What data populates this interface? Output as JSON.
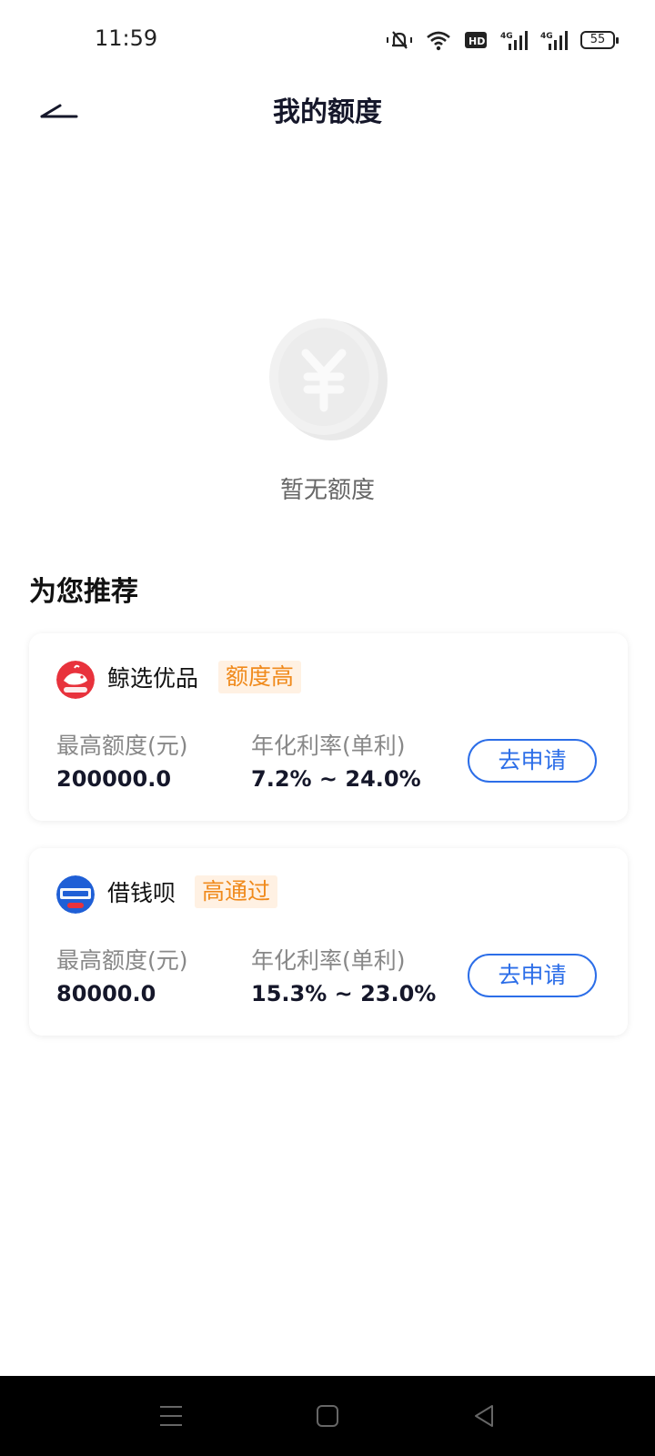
{
  "status_bar": {
    "time": "11:59",
    "network_1": "4G",
    "network_2": "4G",
    "hd_label": "HD",
    "battery": "55"
  },
  "header": {
    "title": "我的额度"
  },
  "empty_state": {
    "text": "暂无额度"
  },
  "section": {
    "title": "为您推荐"
  },
  "products": [
    {
      "name": "鲸选优品",
      "tag": "额度高",
      "max_label": "最高额度(元)",
      "max_value": "200000.0",
      "rate_label": "年化利率(单利)",
      "rate_value": "7.2% ~ 24.0%",
      "button": "去申请",
      "logo_color": "#e8323c"
    },
    {
      "name": "借钱呗",
      "tag": "高通过",
      "max_label": "最高额度(元)",
      "max_value": "80000.0",
      "rate_label": "年化利率(单利)",
      "rate_value": "15.3% ~ 23.0%",
      "button": "去申请",
      "logo_color": "#1f5fd6"
    }
  ],
  "colors": {
    "accent_blue": "#2c6ee8",
    "tag_orange": "#f08a1c",
    "tag_bg": "#fff1e3"
  },
  "icons": [
    "back-arrow-icon",
    "silent-icon",
    "wifi-icon",
    "signal-icon",
    "battery-icon",
    "coin-yuan-icon",
    "menu-icon",
    "home-icon",
    "back-triangle-icon"
  ]
}
